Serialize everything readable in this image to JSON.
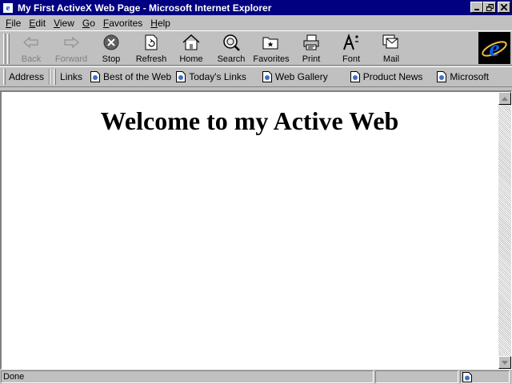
{
  "window": {
    "title": "My First ActiveX Web Page - Microsoft Internet Explorer",
    "icon_glyph": "e"
  },
  "menu": {
    "items": [
      {
        "first": "F",
        "rest": "ile"
      },
      {
        "first": "E",
        "rest": "dit"
      },
      {
        "first": "V",
        "rest": "iew"
      },
      {
        "first": "G",
        "rest": "o"
      },
      {
        "first": "F",
        "rest": "avorites"
      },
      {
        "first": "H",
        "rest": "elp"
      }
    ]
  },
  "toolbar": {
    "back": "Back",
    "forward": "Forward",
    "stop": "Stop",
    "refresh": "Refresh",
    "home": "Home",
    "search": "Search",
    "favorites": "Favorites",
    "print": "Print",
    "font": "Font",
    "mail": "Mail"
  },
  "linksbar": {
    "address_label": "Address",
    "links_label": "Links",
    "links": [
      "Best of the Web",
      "Today's Links",
      "Web Gallery",
      "Product News",
      "Microsoft"
    ]
  },
  "page": {
    "heading": "Welcome to my Active Web"
  },
  "status": {
    "text": "Done"
  },
  "colors": {
    "titlebar": "#000080",
    "chrome": "#c0c0c0",
    "ie_blue": "#1060e0"
  }
}
